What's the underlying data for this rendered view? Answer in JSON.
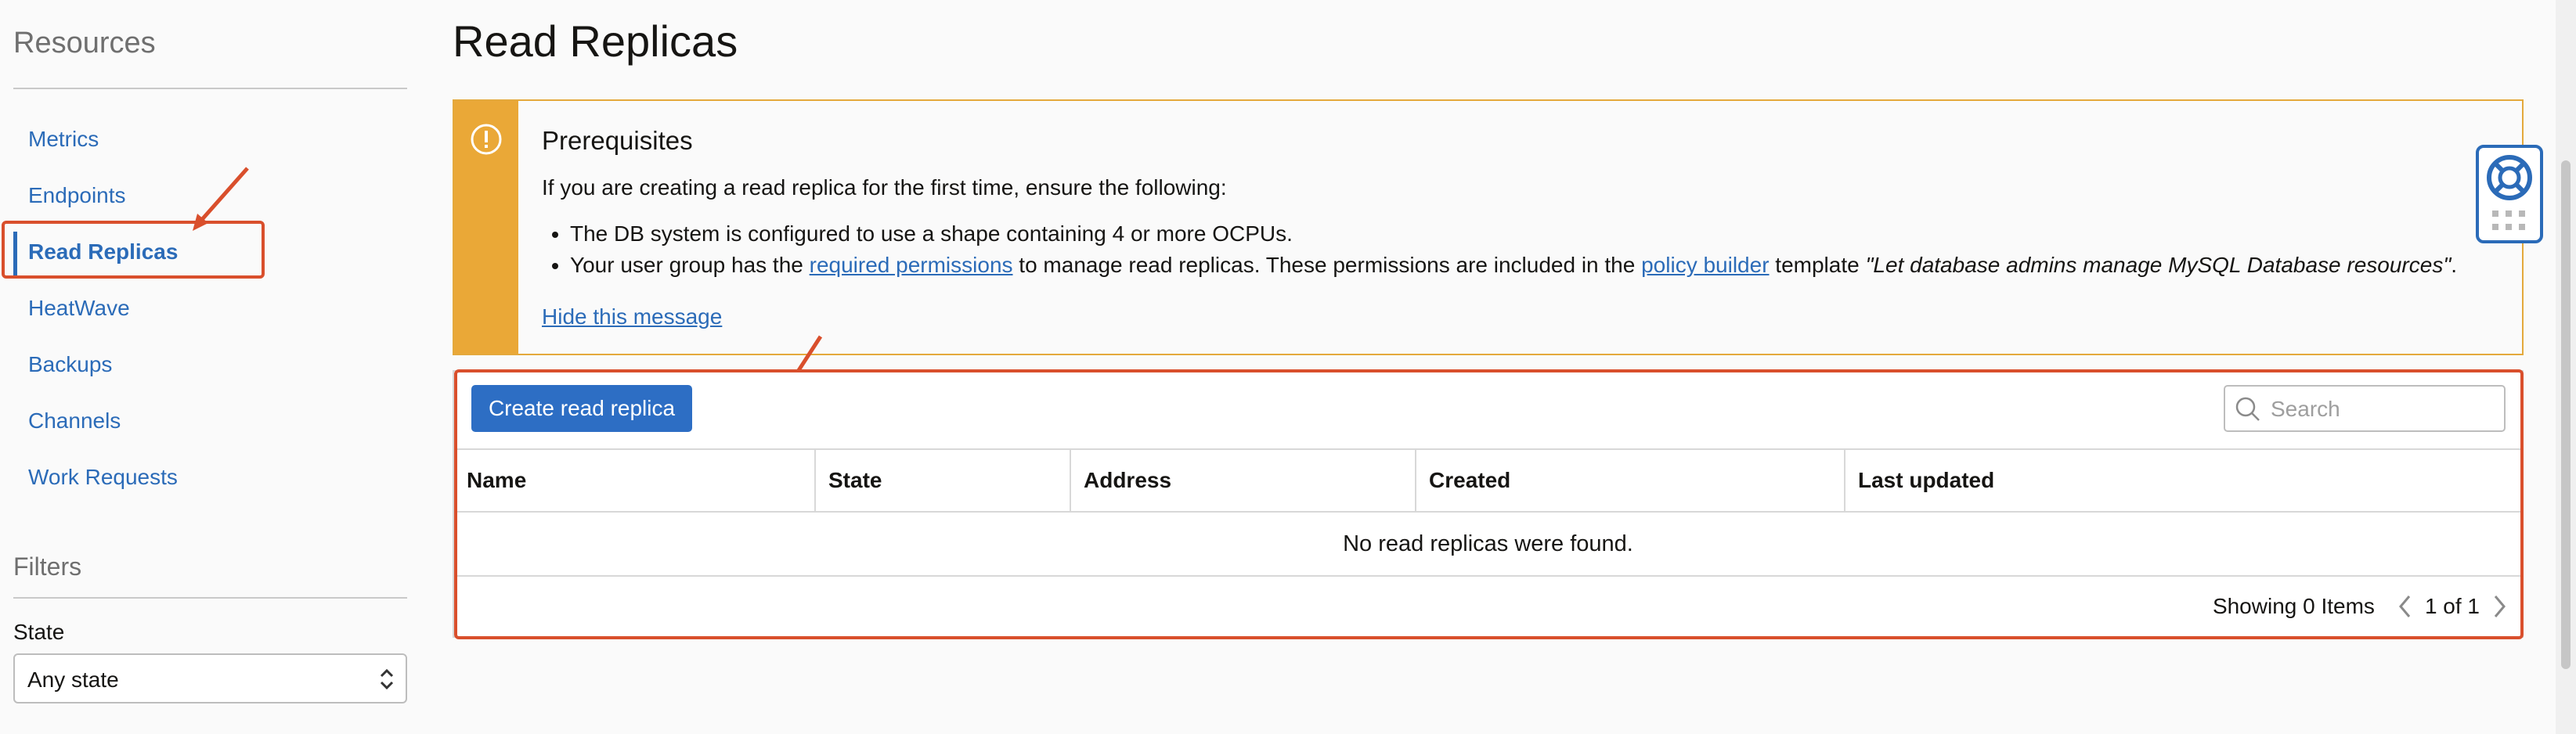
{
  "sidebar": {
    "resources_heading": "Resources",
    "nav": [
      {
        "label": "Metrics"
      },
      {
        "label": "Endpoints"
      },
      {
        "label": "Read Replicas",
        "active": true
      },
      {
        "label": "HeatWave"
      },
      {
        "label": "Backups"
      },
      {
        "label": "Channels"
      },
      {
        "label": "Work Requests"
      }
    ],
    "filters_heading": "Filters",
    "state_label": "State",
    "state_value": "Any state"
  },
  "main": {
    "title": "Read Replicas",
    "notice": {
      "title": "Prerequisites",
      "intro": "If you are creating a read replica for the first time, ensure the following:",
      "bullet1": "The DB system is configured to use a shape containing 4 or more OCPUs.",
      "bullet2_pre": "Your user group has the ",
      "bullet2_link1": "required permissions",
      "bullet2_mid": " to manage read replicas. These permissions are included in the ",
      "bullet2_link2": "policy builder",
      "bullet2_post_pre": " template ",
      "bullet2_template": "\"Let database admins manage MySQL Database resources\"",
      "bullet2_end": ".",
      "hide_link": "Hide this message"
    },
    "table": {
      "create_button": "Create read replica",
      "search_placeholder": "Search",
      "columns": [
        "Name",
        "State",
        "Address",
        "Created",
        "Last updated"
      ],
      "empty_message": "No read replicas were found.",
      "showing": "Showing 0 Items",
      "page": "1 of 1"
    }
  },
  "colors": {
    "accent": "#2b6bb8",
    "warning": "#eaa837",
    "annotation": "#d94f2c",
    "button": "#2d6ec4"
  },
  "icons": [
    "warning-icon",
    "search-icon",
    "chevron-left-icon",
    "chevron-right-icon",
    "help-lifebuoy-icon",
    "grid-icon",
    "select-caret-icon"
  ]
}
